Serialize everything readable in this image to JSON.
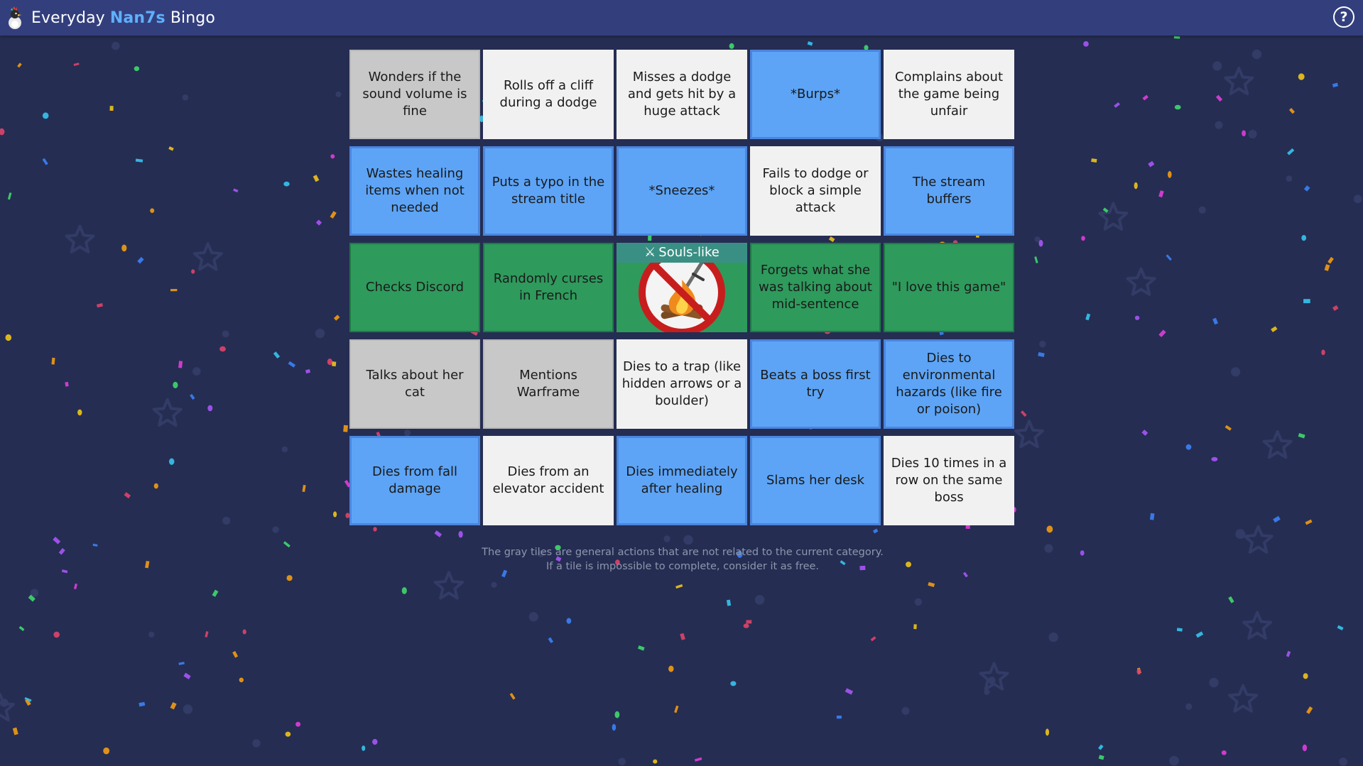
{
  "header": {
    "title_prefix": "Everyday",
    "title_accent": "Nan7s",
    "title_suffix": "Bingo",
    "help_label": "?",
    "logo_icon": "rooster-mascot-icon"
  },
  "colors": {
    "background": "#252d52",
    "header": "#333f7d",
    "accent": "#5fb0ff",
    "tile_white": "#f1f1f1",
    "tile_gray": "#c8c8c8",
    "tile_blue": "#5da4f6",
    "tile_green": "#2e9a5c"
  },
  "board": {
    "rows": [
      [
        {
          "text": "Wonders if the sound volume is fine",
          "state": "gray"
        },
        {
          "text": "Rolls off a cliff during a dodge",
          "state": "white"
        },
        {
          "text": "Misses a dodge and gets hit by a huge attack",
          "state": "white"
        },
        {
          "text": "*Burps*",
          "state": "blue"
        },
        {
          "text": "Complains about the game being unfair",
          "state": "white"
        }
      ],
      [
        {
          "text": "Wastes healing items when not needed",
          "state": "blue"
        },
        {
          "text": "Puts a typo in the stream title",
          "state": "blue"
        },
        {
          "text": "*Sneezes*",
          "state": "blue"
        },
        {
          "text": "Fails to dodge or block a simple attack",
          "state": "white"
        },
        {
          "text": "The stream buffers",
          "state": "blue"
        }
      ],
      [
        {
          "text": "Checks Discord",
          "state": "green"
        },
        {
          "text": "Randomly curses in French",
          "state": "green"
        },
        {
          "text": "Souls-like",
          "state": "free",
          "icon": "no-bonfire-icon",
          "banner_icon": "crossed-swords-icon"
        },
        {
          "text": "Forgets what she was talking about mid-sentence",
          "state": "green"
        },
        {
          "text": "\"I love this game\"",
          "state": "green"
        }
      ],
      [
        {
          "text": "Talks about her cat",
          "state": "gray"
        },
        {
          "text": "Mentions Warframe",
          "state": "gray"
        },
        {
          "text": "Dies to a trap (like hidden arrows or a boulder)",
          "state": "white"
        },
        {
          "text": "Beats a boss first try",
          "state": "blue"
        },
        {
          "text": "Dies to environmental hazards (like fire or poison)",
          "state": "blue"
        }
      ],
      [
        {
          "text": "Dies from fall damage",
          "state": "blue"
        },
        {
          "text": "Dies from an elevator accident",
          "state": "white"
        },
        {
          "text": "Dies immediately after healing",
          "state": "blue"
        },
        {
          "text": "Slams her desk",
          "state": "blue"
        },
        {
          "text": "Dies 10 times in a row on the same boss",
          "state": "white"
        }
      ]
    ]
  },
  "footer": {
    "line1": "The gray tiles are general actions that are not related to the current category.",
    "line2": "If a tile is impossible to complete, consider it as free."
  }
}
